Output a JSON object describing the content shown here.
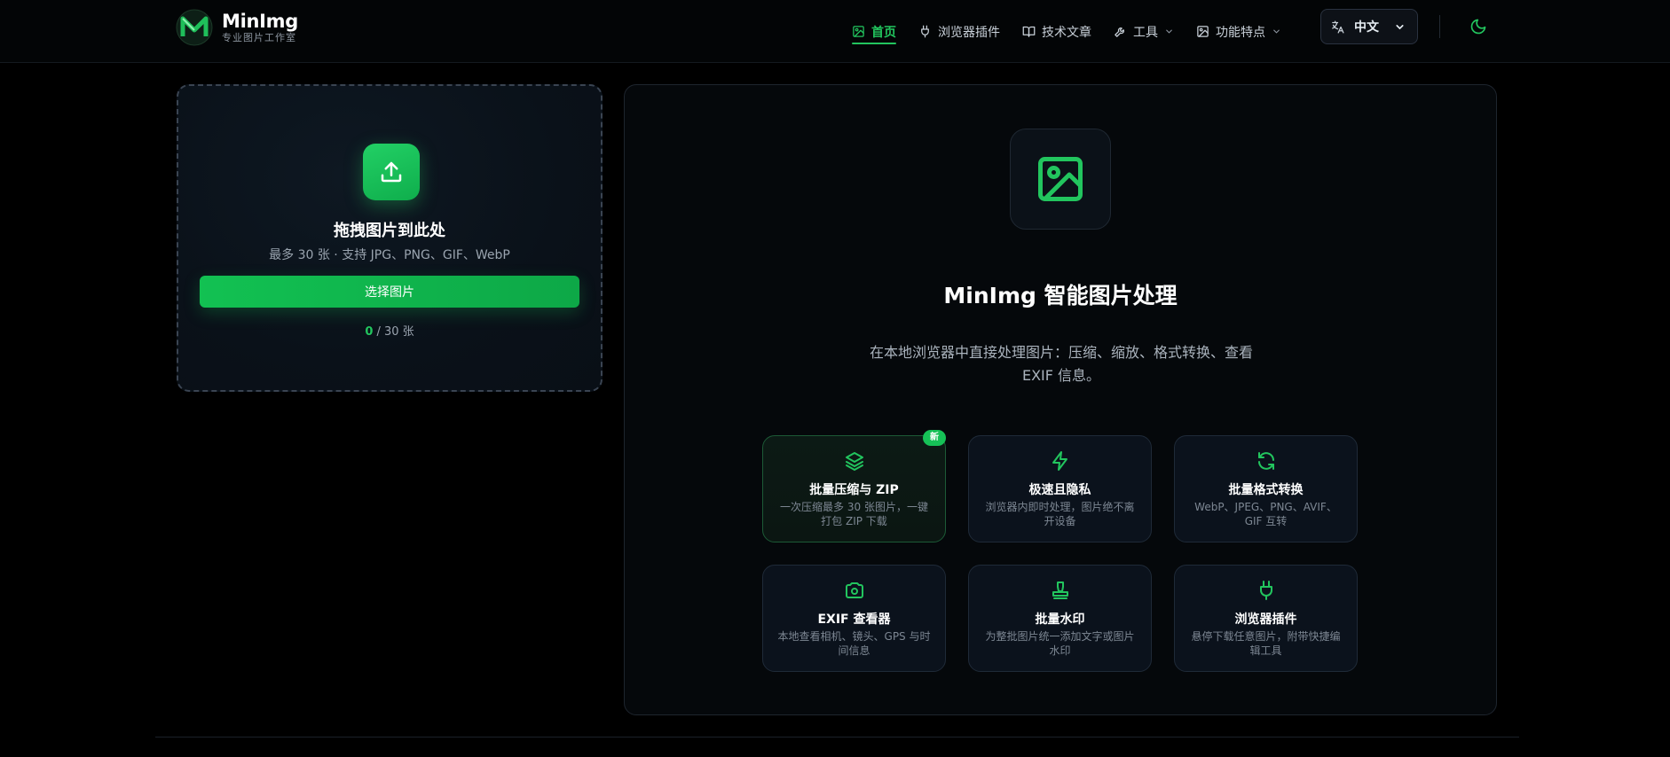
{
  "brand": {
    "name": "MinImg",
    "tagline": "专业图片工作室",
    "accent": "#22c55e"
  },
  "nav": {
    "items": [
      {
        "label": "首页",
        "icon": "image-icon",
        "active": true
      },
      {
        "label": "浏览器插件",
        "icon": "plug-icon",
        "active": false
      },
      {
        "label": "技术文章",
        "icon": "book-icon",
        "active": false
      },
      {
        "label": "工具",
        "icon": "wrench-icon",
        "active": false,
        "dropdown": true
      },
      {
        "label": "功能特点",
        "icon": "image-icon",
        "active": false,
        "dropdown": true
      }
    ],
    "language": "中文",
    "theme_icon": "moon-icon"
  },
  "upload": {
    "title": "拖拽图片到此处",
    "subtitle": "最多 30 张 · 支持 JPG、PNG、GIF、WebP",
    "button_label": "选择图片",
    "count_current": "0",
    "count_suffix": " / 30 张"
  },
  "hero": {
    "title": "MinImg 智能图片处理",
    "description": "在本地浏览器中直接处理图片：压缩、缩放、格式转换、查看 EXIF 信息。"
  },
  "features": [
    {
      "title": "批量压缩与 ZIP",
      "desc": "一次压缩最多 30 张图片，一键打包 ZIP 下载",
      "icon": "layers-icon",
      "badge": "新"
    },
    {
      "title": "极速且隐私",
      "desc": "浏览器内即时处理，图片绝不离开设备",
      "icon": "lightning-icon"
    },
    {
      "title": "批量格式转换",
      "desc": "WebP、JPEG、PNG、AVIF、GIF 互转",
      "icon": "refresh-icon"
    },
    {
      "title": "EXIF 查看器",
      "desc": "本地查看相机、镜头、GPS 与时间信息",
      "icon": "camera-icon"
    },
    {
      "title": "批量水印",
      "desc": "为整批图片统一添加文字或图片水印",
      "icon": "stamp-icon"
    },
    {
      "title": "浏览器插件",
      "desc": "悬停下载任意图片，附带快捷编辑工具",
      "icon": "plug-icon"
    }
  ]
}
